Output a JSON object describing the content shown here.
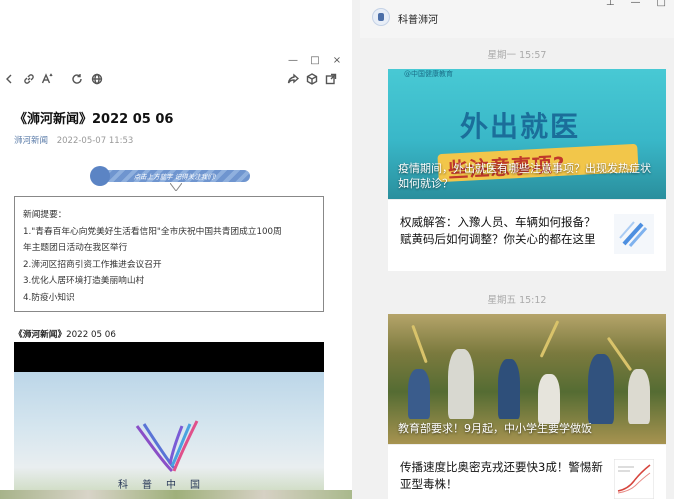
{
  "left_window": {
    "controls": {
      "minimize": "—",
      "restore": "□",
      "close": "×"
    },
    "toolbar": {
      "back_icon": "chevron-left-icon",
      "link_icon": "link-icon",
      "font_icon": "font-size-icon",
      "refresh_icon": "refresh-icon",
      "globe_icon": "globe-icon",
      "share_icon": "share-icon",
      "cube_icon": "cube-icon",
      "open_icon": "open-external-icon"
    },
    "article": {
      "title": "《浉河新闻》2022 05 06",
      "account": "浉河新闻",
      "date": "2022-05-07 11:53",
      "ribbon_text": "点击上方蓝字 记得关注我们!",
      "summary_lines": [
        "新闻提要：",
        "1.\"青春百年心向党美好生活看信阳\"全市庆祝中国共青团成立100周",
        "年主题团日活动在我区举行",
        "2.浉河区招商引资工作推进会议召开",
        "3.优化人居环境打造美丽响山村",
        "4.防疫小知识"
      ],
      "subtitle_bold": "《浉河新闻》",
      "subtitle_rest": "2022 05 06",
      "video_logo_text": "科普中国"
    }
  },
  "right_window": {
    "title": "科普浉河",
    "controls": {
      "pin": "⊥",
      "minimize": "—",
      "restore": "□"
    },
    "timestamps": [
      "星期一 15:57",
      "星期五 15:12"
    ],
    "cards": [
      {
        "cover_title": "疫情期间，外出就医有哪些注意事项？出现发热症状如何就诊？",
        "poster_top": "@中国健康教育",
        "poster_big": "外出就医",
        "poster_stripe": "些注意事项?",
        "sub_title": "权威解答：入豫人员、车辆如何报备？赋黄码后如何调整？你关心的都在这里"
      },
      {
        "cover_title": "教育部要求！9月起，中小学生要学做饭",
        "sub_title": "传播速度比奥密克戎还要快3成！警惕新亚型毒株！"
      }
    ]
  }
}
